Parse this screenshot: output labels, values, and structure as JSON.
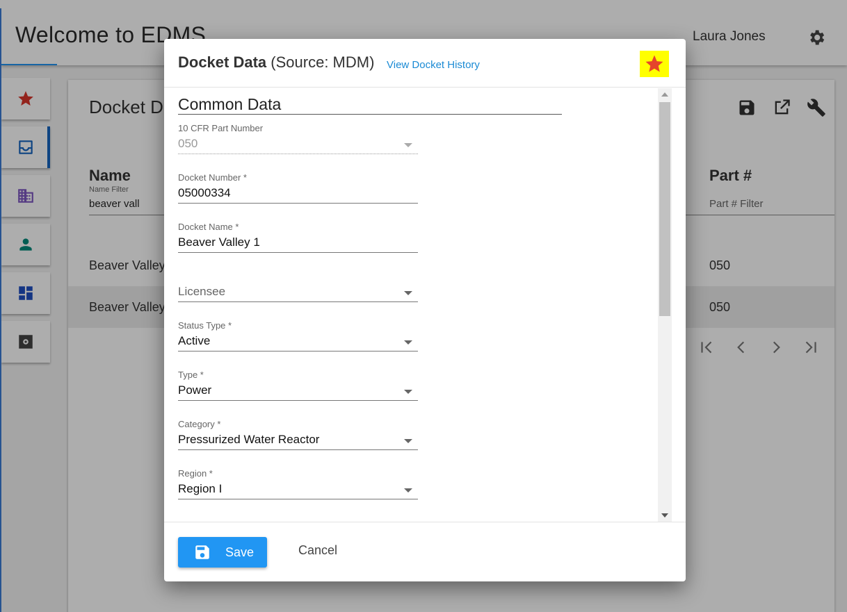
{
  "app": {
    "title": "Welcome to EDMS",
    "user_name": "Laura Jones"
  },
  "card": {
    "title": "Docket Da",
    "columns": {
      "name_header": "Name",
      "name_filter_label": "Name Filter",
      "name_filter_value": "beaver vall",
      "part_header": "Part #",
      "part_filter_placeholder": "Part # Filter"
    },
    "rows": [
      {
        "name": "Beaver Valley",
        "part": "050"
      },
      {
        "name": "Beaver Valley",
        "part": "050"
      }
    ]
  },
  "dialog": {
    "title_bold": "Docket Data",
    "title_source": "(Source: MDM)",
    "history_link": "View Docket History",
    "section_title": "Common Data",
    "fields": {
      "cfr_part": {
        "label": "10 CFR Part Number",
        "value": "050"
      },
      "docket_number": {
        "label": "Docket Number *",
        "value": "05000334"
      },
      "docket_name": {
        "label": "Docket Name *",
        "value": "Beaver Valley 1"
      },
      "licensee": {
        "placeholder": "Licensee"
      },
      "status_type": {
        "label": "Status Type *",
        "value": "Active"
      },
      "type": {
        "label": "Type *",
        "value": "Power"
      },
      "category": {
        "label": "Category *",
        "value": "Pressurized Water Reactor"
      },
      "region": {
        "label": "Region *",
        "value": "Region I"
      }
    },
    "save_label": "Save",
    "cancel_label": "Cancel"
  },
  "colors": {
    "accent": "#2196f3",
    "favorite_star": "#e5452b",
    "favorite_highlight": "#ffff00",
    "link": "#1a8ad4"
  },
  "icons": {
    "topbar": [
      "gear-icon"
    ],
    "rail": [
      "star-icon",
      "inbox-icon",
      "building-icon",
      "person-icon",
      "dashboard-icon",
      "settings-box-icon"
    ],
    "card_tools": [
      "save-icon",
      "open-external-icon",
      "wrench-icon"
    ],
    "pager": [
      "first-page-icon",
      "prev-page-icon",
      "next-page-icon",
      "last-page-icon"
    ],
    "dialog": [
      "favorite-star-icon",
      "save-icon"
    ]
  }
}
